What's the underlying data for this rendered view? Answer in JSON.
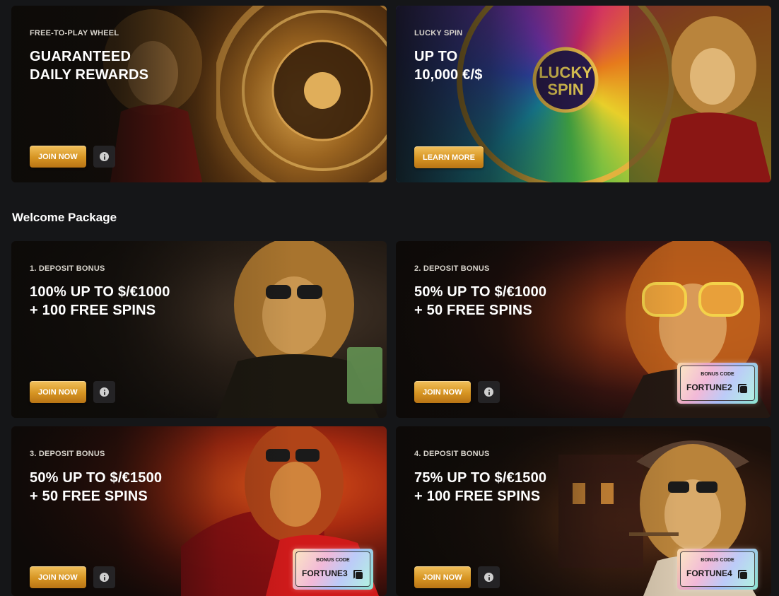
{
  "promo_cards": [
    {
      "eyebrow": "FREE-TO-PLAY WHEEL",
      "headline_line1": "GUARANTEED",
      "headline_line2": "DAILY REWARDS",
      "button_label": "JOIN NOW"
    },
    {
      "eyebrow": "LUCKY SPIN",
      "headline_line1": "UP TO",
      "headline_line2": "10,000 €/$",
      "button_label": "LEARN MORE"
    }
  ],
  "welcome": {
    "title": "Welcome Package",
    "code_label": "BONUS CODE",
    "cards": [
      {
        "eyebrow": "1. DEPOSIT BONUS",
        "headline_line1": "100% UP TO $/€1000",
        "headline_line2": "+ 100 FREE SPINS",
        "button_label": "JOIN NOW"
      },
      {
        "eyebrow": "2. DEPOSIT BONUS",
        "headline_line1": "50% UP TO $/€1000",
        "headline_line2": "+ 50 FREE SPINS",
        "button_label": "JOIN NOW",
        "bonus_code": "FORTUNE2"
      },
      {
        "eyebrow": "3. DEPOSIT BONUS",
        "headline_line1": "50% UP TO $/€1500",
        "headline_line2": "+ 50 FREE SPINS",
        "button_label": "JOIN NOW",
        "bonus_code": "FORTUNE3"
      },
      {
        "eyebrow": "4. DEPOSIT BONUS",
        "headline_line1": "75% UP TO $/€1500",
        "headline_line2": "+ 100 FREE SPINS",
        "button_label": "JOIN NOW",
        "bonus_code": "FORTUNE4"
      }
    ]
  },
  "icons": {
    "info": "info-icon",
    "copy": "copy-icon"
  },
  "colors": {
    "page_background": "#151618",
    "button_gold": "#d69422"
  }
}
